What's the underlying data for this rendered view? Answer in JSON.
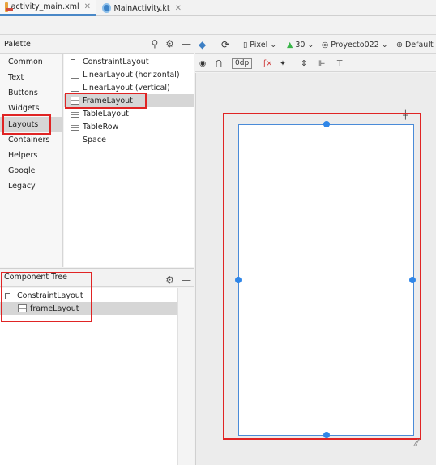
{
  "tabs": [
    {
      "label": "activity_main.xml",
      "active": true
    },
    {
      "label": "MainActivity.kt",
      "active": false
    }
  ],
  "palette": {
    "title": "Palette",
    "categories": [
      "Common",
      "Text",
      "Buttons",
      "Widgets",
      "Layouts",
      "Containers",
      "Helpers",
      "Google",
      "Legacy"
    ],
    "selected_category": "Layouts",
    "items": [
      "ConstraintLayout",
      "LinearLayout (horizontal)",
      "LinearLayout (vertical)",
      "FrameLayout",
      "TableLayout",
      "TableRow",
      "Space"
    ],
    "selected_item": "FrameLayout"
  },
  "component_tree": {
    "title": "Component Tree",
    "nodes": [
      {
        "label": "ConstraintLayout",
        "level": 0
      },
      {
        "label": "frameLayout",
        "level": 1,
        "selected": true
      }
    ]
  },
  "design_toolbar": {
    "device": "Pixel",
    "api": "30",
    "theme": "Proyecto022",
    "locale": "Default",
    "margin": "0dp"
  },
  "colors": {
    "highlight_border": "#e02424",
    "selection_blue": "#2f86e8",
    "tab_underline": "#4a88c7"
  }
}
